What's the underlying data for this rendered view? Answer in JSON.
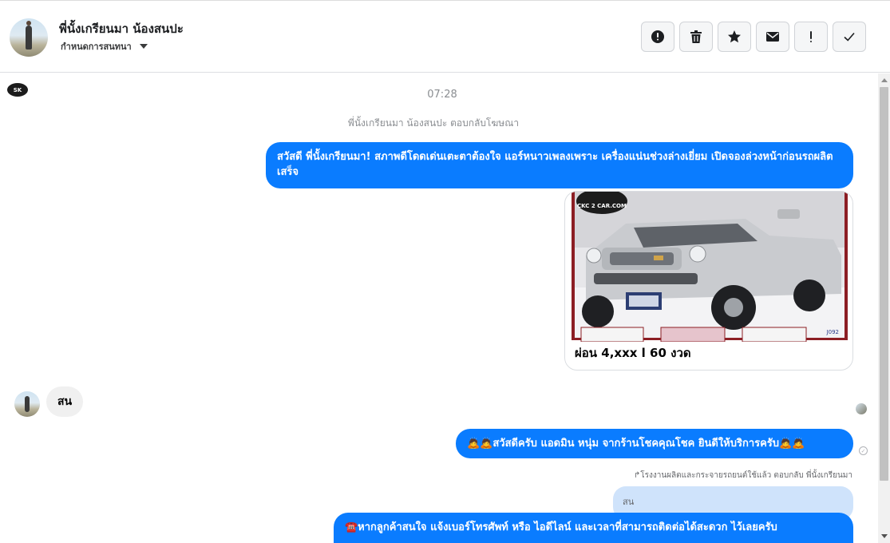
{
  "header": {
    "contact_name": "พี่นั้งเกรียนมา น้องสนปะ",
    "assign_label": "กำหนดการสนทนา",
    "actions": [
      {
        "name": "report",
        "icon": "exclamation-circle-icon",
        "label": "!"
      },
      {
        "name": "delete",
        "icon": "trash-icon"
      },
      {
        "name": "star",
        "icon": "star-icon"
      },
      {
        "name": "mark-unread",
        "icon": "envelope-icon"
      },
      {
        "name": "important",
        "icon": "exclamation-icon",
        "label": "!"
      },
      {
        "name": "done",
        "icon": "check-icon"
      }
    ]
  },
  "chat": {
    "page_logo_text": "SK",
    "time": "07:28",
    "ad_reply_meta": "พี่นั้งเกรียนมา น้องสนปะ ตอบกลับโฆษณา",
    "outgoing_1": "สวัสดี พี่นั้งเกรียนมา! สภาพดีโดดเด่นเตะตาต้องใจ แอร์หนาวเพลงเพราะ เครื่องแน่นช่วงล่างเยี่ยม เปิดจองล่วงหน้าก่อนรถผลิตเสร็จ",
    "card": {
      "watermark": "CKC 2 CAR.COM",
      "code": "J092",
      "title": "ผ่อน 4,xxx l 60 งวด"
    },
    "incoming_1": "สน",
    "outgoing_2": "🙇🙇สวัสดีครับ แอดมิน หนุ่ม จากร้านโชคคุณโชค ยินดีให้บริการครับ🙇🙇",
    "reply_meta": "↱โรงงานผลิตและกระจายรถยนต์ใช้แล้ว ตอบกลับ พี่นั้งเกรียนมา",
    "quoted_text": "สน",
    "outgoing_3": "☎️หากลูกค้าสนใจ แจ้งเบอร์โทรศัพท์ หรือ ไอดีไลน์ และเวลาที่สามารถติดต่อได้สะดวก ไว้เลยครับ"
  },
  "colors": {
    "outgoing_bubble": "#0a7cff",
    "incoming_bubble": "#f0f0f0",
    "quote_bubble": "#cfe3fb"
  }
}
